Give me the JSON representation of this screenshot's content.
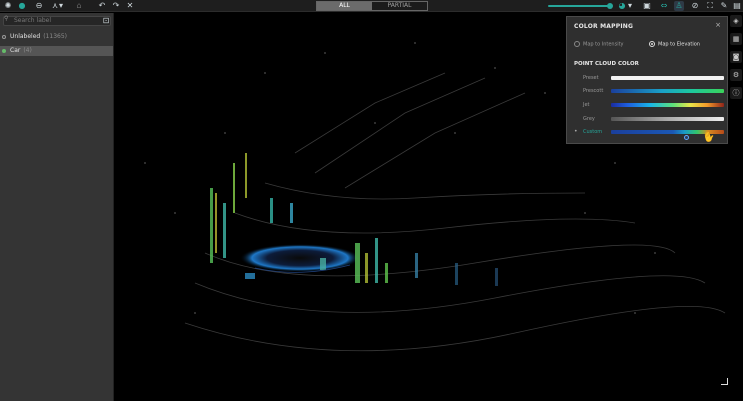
{
  "toolbar": {
    "mode_tabs": [
      "ALL",
      "PARTIAL"
    ],
    "icons": [
      "app-logo-icon",
      "globe-icon",
      "circle-icon",
      "shape-tool-icon",
      "chevron-down-icon",
      "trash-icon",
      "undo-icon",
      "redo-icon",
      "close-icon"
    ]
  },
  "sidebar": {
    "search_placeholder": "Search label",
    "layers": [
      {
        "name": "Unlabeled",
        "count": "(11365)",
        "selected": false
      },
      {
        "name": "Car",
        "count": "(4)",
        "selected": true
      }
    ]
  },
  "color_mapping": {
    "title": "COLOR MAPPING",
    "close": "×",
    "options": [
      {
        "label": "Map to Intensity",
        "selected": false
      },
      {
        "label": "Map to Elevation",
        "selected": true
      }
    ],
    "section_title": "POINT CLOUD COLOR",
    "palettes": [
      {
        "label": "Preset",
        "style": "preset"
      },
      {
        "label": "Prescott",
        "style": "prescott"
      },
      {
        "label": "Jet",
        "style": "jet"
      },
      {
        "label": "Grey",
        "style": "grey"
      },
      {
        "label": "Custom",
        "style": "custom",
        "current": true
      }
    ]
  },
  "colors": {
    "accent": "#26a69a",
    "panel": "#343434",
    "popup": "#2f2f2f"
  }
}
